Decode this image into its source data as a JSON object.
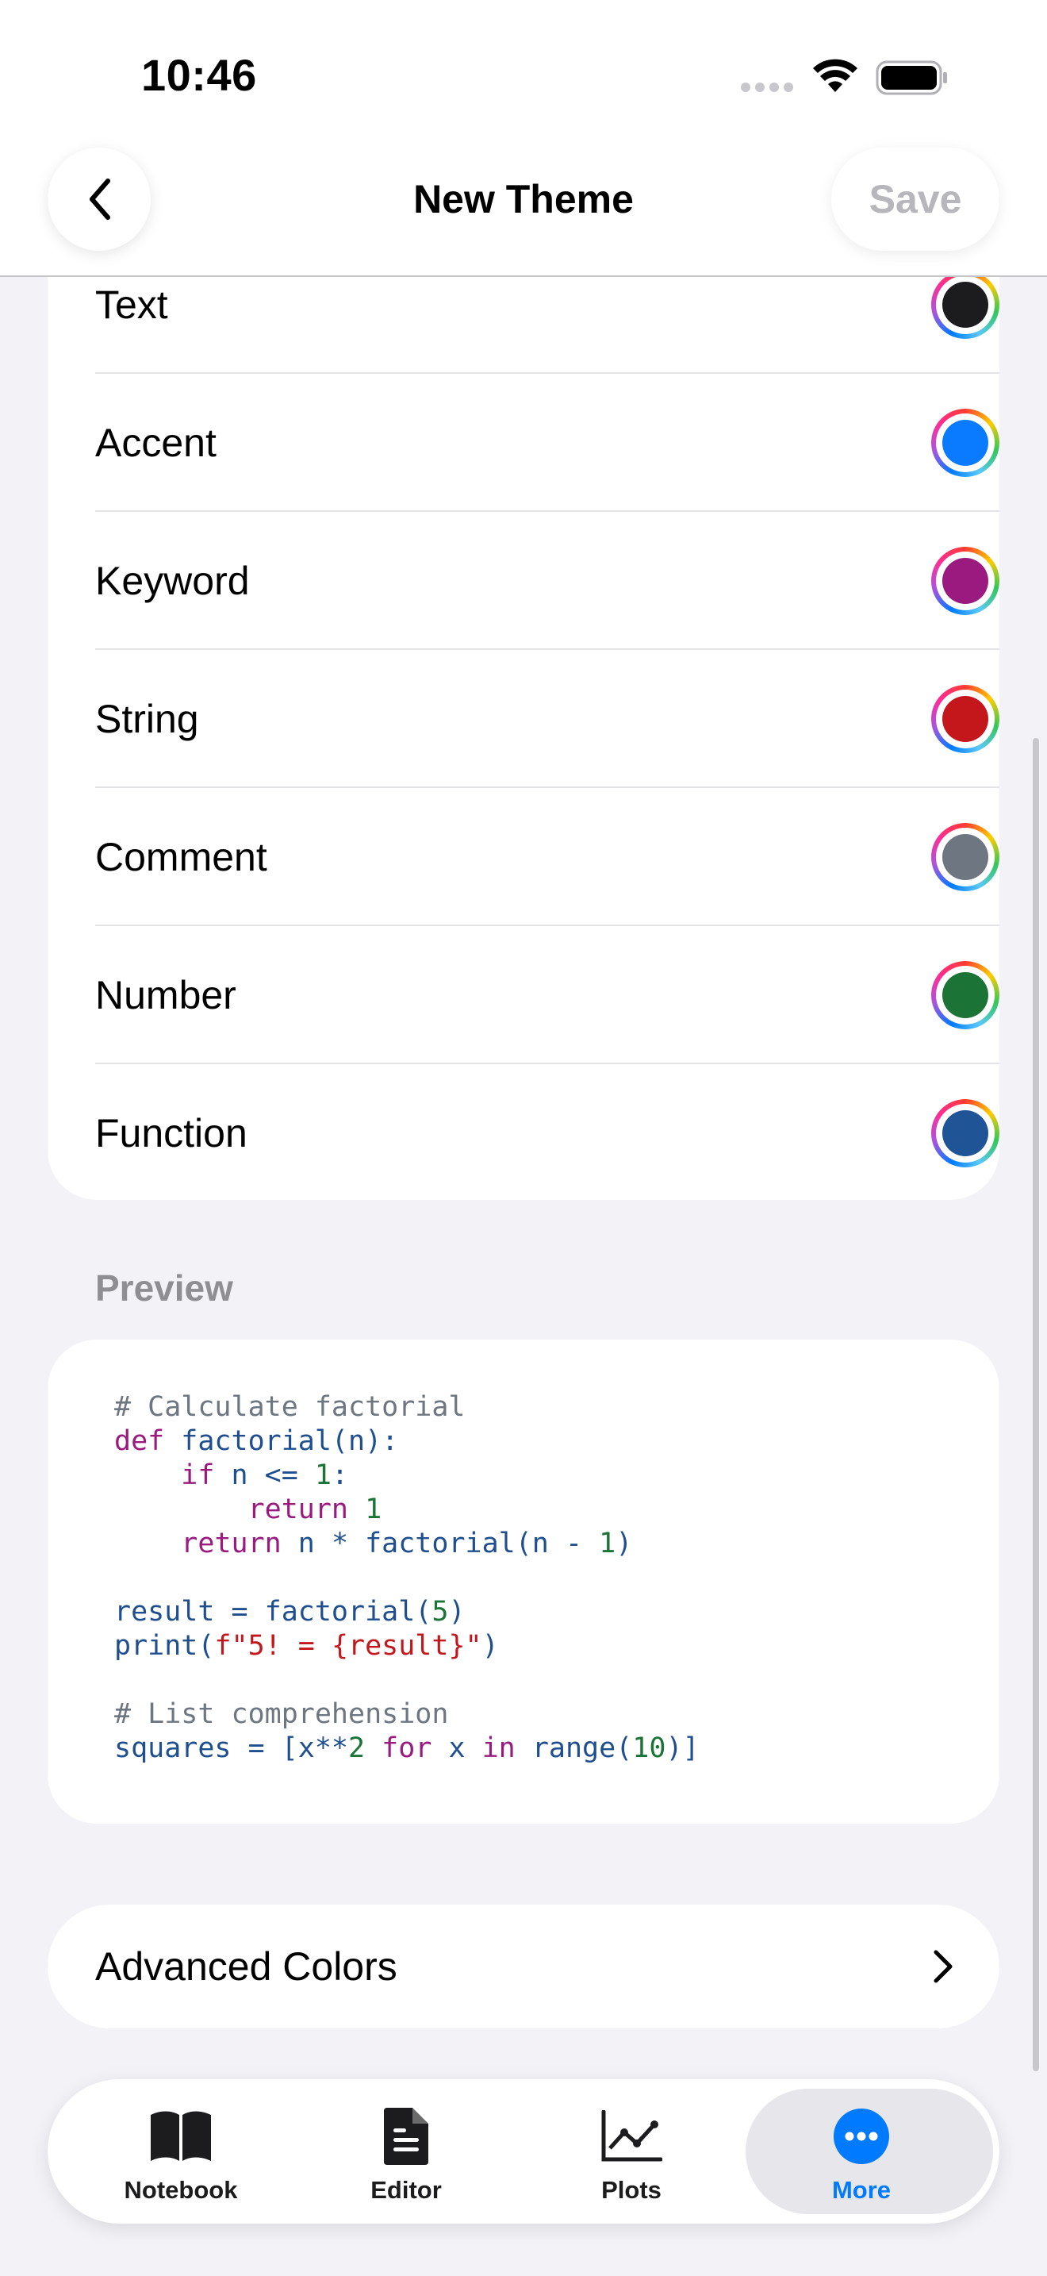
{
  "status_bar": {
    "time": "10:46"
  },
  "navbar": {
    "title": "New Theme",
    "save_label": "Save"
  },
  "color_rows": [
    {
      "label": "Text",
      "color": "#1c1c1e"
    },
    {
      "label": "Accent",
      "color": "#0a7aff"
    },
    {
      "label": "Keyword",
      "color": "#9b1a80"
    },
    {
      "label": "String",
      "color": "#c4171c"
    },
    {
      "label": "Comment",
      "color": "#6d7681"
    },
    {
      "label": "Number",
      "color": "#1b7436"
    },
    {
      "label": "Function",
      "color": "#1f5597"
    }
  ],
  "preview": {
    "header": "Preview",
    "code_lines": [
      [
        [
          "comment",
          "# Calculate factorial"
        ]
      ],
      [
        [
          "keyword",
          "def"
        ],
        [
          "plain",
          " factorial(n):"
        ]
      ],
      [
        [
          "plain",
          "    "
        ],
        [
          "keyword",
          "if"
        ],
        [
          "plain",
          " n <= "
        ],
        [
          "number",
          "1"
        ],
        [
          "plain",
          ":"
        ]
      ],
      [
        [
          "plain",
          "        "
        ],
        [
          "keyword",
          "return"
        ],
        [
          "plain",
          " "
        ],
        [
          "number",
          "1"
        ]
      ],
      [
        [
          "plain",
          "    "
        ],
        [
          "keyword",
          "return"
        ],
        [
          "plain",
          " n * factorial(n - "
        ],
        [
          "number",
          "1"
        ],
        [
          "plain",
          ")"
        ]
      ],
      [
        [
          "plain",
          ""
        ]
      ],
      [
        [
          "plain",
          "result = factorial("
        ],
        [
          "number",
          "5"
        ],
        [
          "plain",
          ")"
        ]
      ],
      [
        [
          "plain",
          "print("
        ],
        [
          "string",
          "f\"5! = {result}\""
        ],
        [
          "plain",
          ")"
        ]
      ],
      [
        [
          "plain",
          ""
        ]
      ],
      [
        [
          "comment",
          "# List comprehension"
        ]
      ],
      [
        [
          "plain",
          "squares = [x**"
        ],
        [
          "number",
          "2"
        ],
        [
          "plain",
          " "
        ],
        [
          "keyword",
          "for"
        ],
        [
          "plain",
          " x "
        ],
        [
          "keyword",
          "in"
        ],
        [
          "plain",
          " range("
        ],
        [
          "number",
          "10"
        ],
        [
          "plain",
          ")]"
        ]
      ]
    ],
    "token_colors": {
      "comment": "#6d7681",
      "keyword": "#9b1a80",
      "plain": "#1f4f8f",
      "number": "#1b7436",
      "string": "#c4171c"
    }
  },
  "advanced": {
    "label": "Advanced Colors"
  },
  "tabs": [
    {
      "label": "Notebook",
      "icon": "book-icon"
    },
    {
      "label": "Editor",
      "icon": "document-icon"
    },
    {
      "label": "Plots",
      "icon": "chart-icon"
    },
    {
      "label": "More",
      "icon": "more-icon",
      "selected": true
    }
  ],
  "accent_color": "#007aff"
}
